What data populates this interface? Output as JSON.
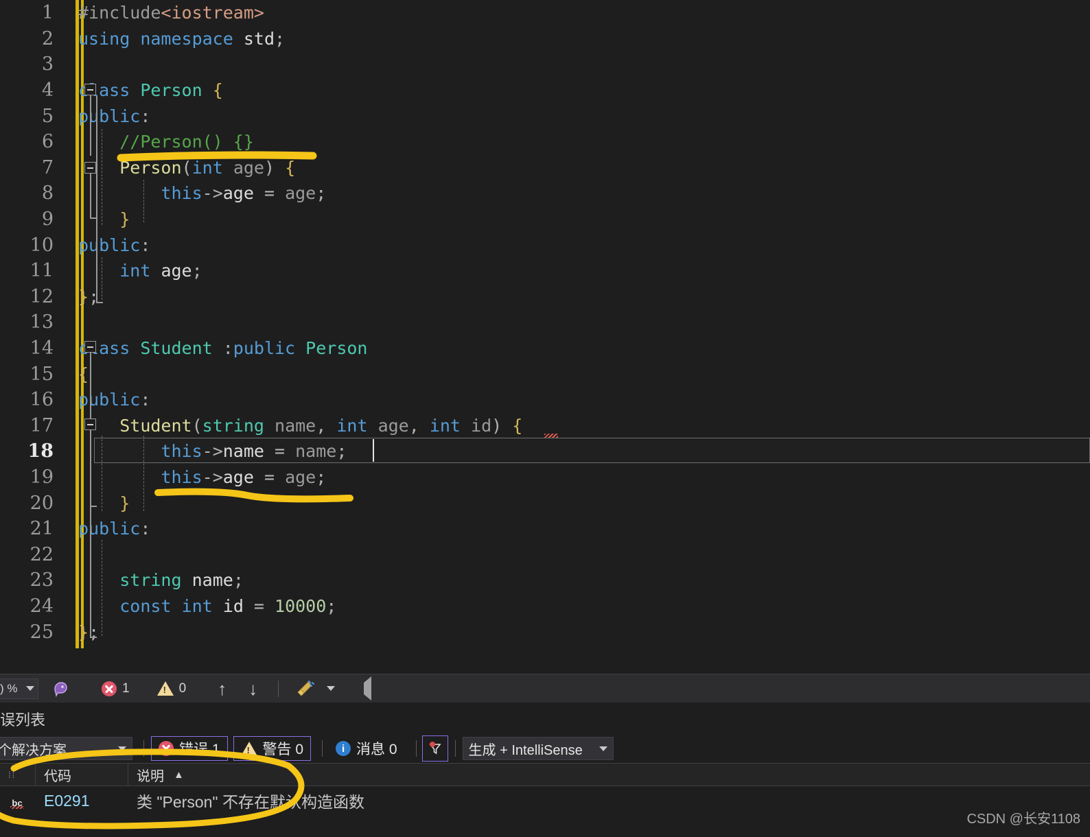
{
  "editor": {
    "language": "cpp",
    "current_line": 18,
    "caret_after": "this->name = name;",
    "background": "#1e1e1e",
    "lines": [
      {
        "n": 1,
        "tokens": [
          {
            "t": "#include",
            "c": "pp"
          },
          {
            "t": "<iostream>",
            "c": "angle"
          }
        ]
      },
      {
        "n": 2,
        "tokens": [
          {
            "t": "using",
            "c": "kw"
          },
          {
            "t": " ",
            "c": "id"
          },
          {
            "t": "namespace",
            "c": "kw"
          },
          {
            "t": " ",
            "c": "id"
          },
          {
            "t": "std",
            "c": "white"
          },
          {
            "t": ";",
            "c": "op"
          }
        ]
      },
      {
        "n": 3,
        "tokens": []
      },
      {
        "n": 4,
        "tokens": [
          {
            "t": "class",
            "c": "kw"
          },
          {
            "t": " ",
            "c": "id"
          },
          {
            "t": "Person",
            "c": "type"
          },
          {
            "t": " ",
            "c": "id"
          },
          {
            "t": "{",
            "c": "brace"
          }
        ]
      },
      {
        "n": 5,
        "tokens": [
          {
            "t": "public",
            "c": "kw"
          },
          {
            "t": ":",
            "c": "op"
          }
        ]
      },
      {
        "n": 6,
        "tokens": [
          {
            "t": "    ",
            "c": "id"
          },
          {
            "t": "//Person() {}",
            "c": "com"
          }
        ]
      },
      {
        "n": 7,
        "tokens": [
          {
            "t": "    ",
            "c": "id"
          },
          {
            "t": "Person",
            "c": "fn"
          },
          {
            "t": "(",
            "c": "op"
          },
          {
            "t": "int",
            "c": "kw"
          },
          {
            "t": " ",
            "c": "id"
          },
          {
            "t": "age",
            "c": "id"
          },
          {
            "t": ")",
            "c": "op"
          },
          {
            "t": " ",
            "c": "id"
          },
          {
            "t": "{",
            "c": "brace"
          }
        ]
      },
      {
        "n": 8,
        "tokens": [
          {
            "t": "        ",
            "c": "id"
          },
          {
            "t": "this",
            "c": "kw"
          },
          {
            "t": "->",
            "c": "op"
          },
          {
            "t": "age",
            "c": "white"
          },
          {
            "t": " = ",
            "c": "op"
          },
          {
            "t": "age",
            "c": "id"
          },
          {
            "t": ";",
            "c": "op"
          }
        ]
      },
      {
        "n": 9,
        "tokens": [
          {
            "t": "    ",
            "c": "id"
          },
          {
            "t": "}",
            "c": "brace"
          }
        ]
      },
      {
        "n": 10,
        "tokens": [
          {
            "t": "public",
            "c": "kw"
          },
          {
            "t": ":",
            "c": "op"
          }
        ]
      },
      {
        "n": 11,
        "tokens": [
          {
            "t": "    ",
            "c": "id"
          },
          {
            "t": "int",
            "c": "kw"
          },
          {
            "t": " ",
            "c": "id"
          },
          {
            "t": "age",
            "c": "white"
          },
          {
            "t": ";",
            "c": "op"
          }
        ]
      },
      {
        "n": 12,
        "tokens": [
          {
            "t": "}",
            "c": "brace"
          },
          {
            "t": ";",
            "c": "op"
          }
        ]
      },
      {
        "n": 13,
        "tokens": []
      },
      {
        "n": 14,
        "tokens": [
          {
            "t": "class",
            "c": "kw"
          },
          {
            "t": " ",
            "c": "id"
          },
          {
            "t": "Student",
            "c": "type"
          },
          {
            "t": " :",
            "c": "op"
          },
          {
            "t": "public",
            "c": "kw"
          },
          {
            "t": " ",
            "c": "id"
          },
          {
            "t": "Person",
            "c": "type"
          }
        ]
      },
      {
        "n": 15,
        "tokens": [
          {
            "t": "{",
            "c": "brace"
          }
        ]
      },
      {
        "n": 16,
        "tokens": [
          {
            "t": "public",
            "c": "kw"
          },
          {
            "t": ":",
            "c": "op"
          }
        ]
      },
      {
        "n": 17,
        "tokens": [
          {
            "t": "    ",
            "c": "id"
          },
          {
            "t": "Student",
            "c": "fn"
          },
          {
            "t": "(",
            "c": "op"
          },
          {
            "t": "string",
            "c": "type"
          },
          {
            "t": " ",
            "c": "id"
          },
          {
            "t": "name",
            "c": "id"
          },
          {
            "t": ", ",
            "c": "op"
          },
          {
            "t": "int",
            "c": "kw"
          },
          {
            "t": " ",
            "c": "id"
          },
          {
            "t": "age",
            "c": "id"
          },
          {
            "t": ", ",
            "c": "op"
          },
          {
            "t": "int",
            "c": "kw"
          },
          {
            "t": " ",
            "c": "id"
          },
          {
            "t": "id",
            "c": "id"
          },
          {
            "t": ")",
            "c": "op"
          },
          {
            "t": " ",
            "c": "id"
          },
          {
            "t": "{",
            "c": "brace"
          }
        ]
      },
      {
        "n": 18,
        "tokens": [
          {
            "t": "        ",
            "c": "id"
          },
          {
            "t": "this",
            "c": "kw"
          },
          {
            "t": "->",
            "c": "op"
          },
          {
            "t": "name",
            "c": "white"
          },
          {
            "t": " = ",
            "c": "op"
          },
          {
            "t": "name",
            "c": "id"
          },
          {
            "t": ";",
            "c": "op"
          }
        ]
      },
      {
        "n": 19,
        "tokens": [
          {
            "t": "        ",
            "c": "id"
          },
          {
            "t": "this",
            "c": "kw"
          },
          {
            "t": "->",
            "c": "op"
          },
          {
            "t": "age",
            "c": "white"
          },
          {
            "t": " = ",
            "c": "op"
          },
          {
            "t": "age",
            "c": "id"
          },
          {
            "t": ";",
            "c": "op"
          }
        ]
      },
      {
        "n": 20,
        "tokens": [
          {
            "t": "    ",
            "c": "id"
          },
          {
            "t": "}",
            "c": "brace"
          }
        ]
      },
      {
        "n": 21,
        "tokens": [
          {
            "t": "public",
            "c": "kw"
          },
          {
            "t": ":",
            "c": "op"
          }
        ]
      },
      {
        "n": 22,
        "tokens": []
      },
      {
        "n": 23,
        "tokens": [
          {
            "t": "    ",
            "c": "id"
          },
          {
            "t": "string",
            "c": "type"
          },
          {
            "t": " ",
            "c": "id"
          },
          {
            "t": "name",
            "c": "white"
          },
          {
            "t": ";",
            "c": "op"
          }
        ]
      },
      {
        "n": 24,
        "tokens": [
          {
            "t": "    ",
            "c": "id"
          },
          {
            "t": "const",
            "c": "kw"
          },
          {
            "t": " ",
            "c": "id"
          },
          {
            "t": "int",
            "c": "kw"
          },
          {
            "t": " ",
            "c": "id"
          },
          {
            "t": "id",
            "c": "white"
          },
          {
            "t": " = ",
            "c": "op"
          },
          {
            "t": "10000",
            "c": "num"
          },
          {
            "t": ";",
            "c": "op"
          }
        ]
      },
      {
        "n": 25,
        "tokens": [
          {
            "t": "}",
            "c": "brace"
          },
          {
            "t": ";",
            "c": "op"
          }
        ]
      }
    ]
  },
  "toolbar": {
    "zoom_level": ") %",
    "quickactions_icon": "brain-icon",
    "error_count": "1",
    "warning_count": "0",
    "prev_label": "↑",
    "next_label": "↓",
    "cleanup_icon": "broom-icon",
    "collapse_icon": "chevron-left-icon"
  },
  "error_list": {
    "title": "误列表",
    "scope": "个解决方案",
    "filters": [
      {
        "name": "errors",
        "icon": "error-circle-icon",
        "label": "错误 1",
        "outlined": true
      },
      {
        "name": "warnings",
        "icon": "warning-triangle-icon",
        "label": "警告 0",
        "outlined": true
      },
      {
        "name": "messages",
        "icon": "info-circle-icon",
        "label": "消息 0",
        "outlined": false
      }
    ],
    "funnel_icon": "funnel-filter-icon",
    "build_filter": "生成 + IntelliSense",
    "columns": [
      "代码",
      "说明"
    ],
    "sort_indicator": "▲",
    "rows": [
      {
        "icon": "bc-squiggle-icon",
        "code": "E0291",
        "description": "类 \"Person\" 不存在默认构造函数"
      }
    ]
  },
  "annotations": {
    "color": "#f5c518",
    "strokes": [
      "underline-person-ctor",
      "underline-student-body-end",
      "ellipse-around-error-row"
    ]
  },
  "watermark": "CSDN @长安1108"
}
